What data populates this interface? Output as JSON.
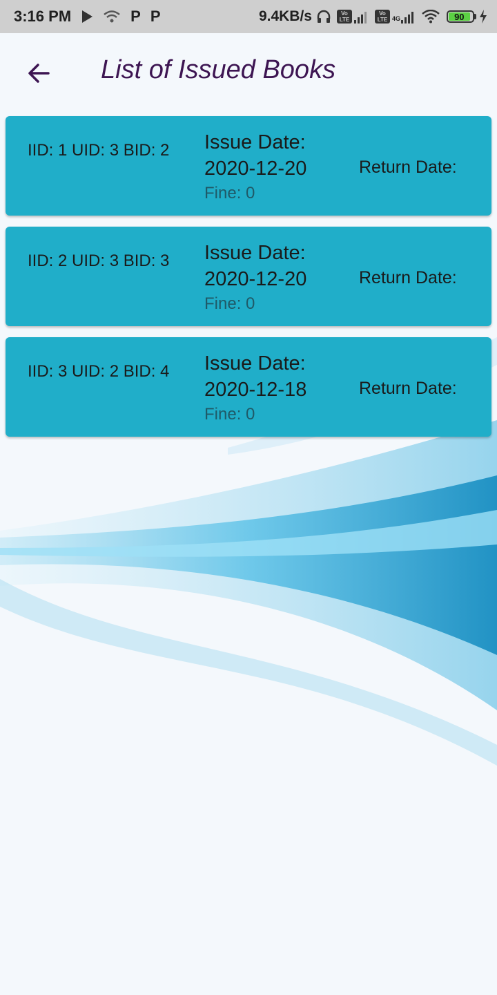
{
  "status_bar": {
    "time": "3:16 PM",
    "icons": [
      "play-icon",
      "wifi-hotspot-icon",
      "parking-p-icon",
      "parking-p-icon",
      "headphones-icon",
      "volte-icon",
      "signal-icon",
      "wifi-icon",
      "charging-bolt-icon"
    ],
    "p1": "P",
    "p2": "P",
    "net_speed": "9.4KB/s",
    "network_tag": "4G",
    "volte_label": "Vo LTE",
    "battery": "90",
    "battery_color": "#5bd143"
  },
  "app_bar": {
    "title": "List of Issued Books",
    "back_icon": "arrow-left-icon",
    "title_color": "#3d1552"
  },
  "theme": {
    "card_color": "#20aec9"
  },
  "issues": [
    {
      "ids": "IID: 1 UID: 3 BID: 2",
      "issue_label": "Issue Date:",
      "issue_date": "2020-12-20",
      "fine": "Fine: 0",
      "return_label": "Return Date:"
    },
    {
      "ids": "IID: 2 UID: 3 BID: 3",
      "issue_label": "Issue Date:",
      "issue_date": "2020-12-20",
      "fine": "Fine: 0",
      "return_label": "Return Date:"
    },
    {
      "ids": "IID: 3 UID: 2 BID: 4",
      "issue_label": "Issue Date:",
      "issue_date": "2020-12-18",
      "fine": "Fine: 0",
      "return_label": "Return Date:"
    }
  ]
}
